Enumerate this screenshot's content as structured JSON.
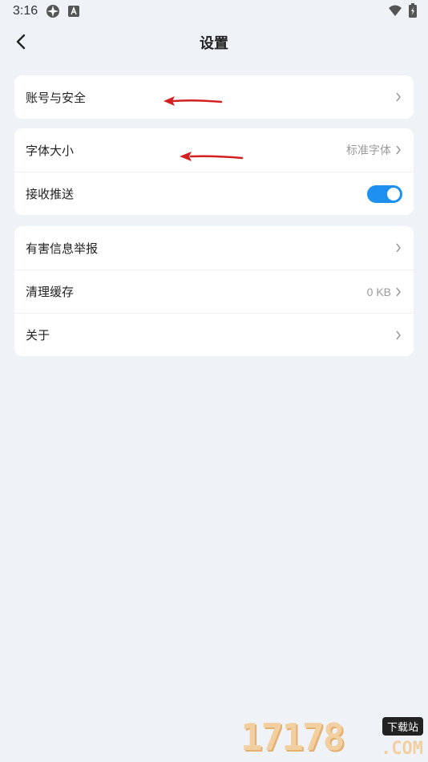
{
  "status_bar": {
    "time": "3:16"
  },
  "header": {
    "title": "设置"
  },
  "groups": [
    {
      "items": [
        {
          "label": "账号与安全",
          "value": ""
        }
      ]
    },
    {
      "items": [
        {
          "label": "字体大小",
          "value": "标准字体"
        },
        {
          "label": "接收推送",
          "value": "",
          "toggle_on": true
        }
      ]
    },
    {
      "items": [
        {
          "label": "有害信息举报",
          "value": ""
        },
        {
          "label": "清理缓存",
          "value": "0 KB"
        },
        {
          "label": "关于",
          "value": ""
        }
      ]
    }
  ],
  "watermark": {
    "number": "17178",
    "badge": "下载站",
    "suffix": ".COM"
  },
  "colors": {
    "background": "#eff3f7",
    "accent": "#1e90f0",
    "annotation_arrow": "#d21f1f"
  }
}
